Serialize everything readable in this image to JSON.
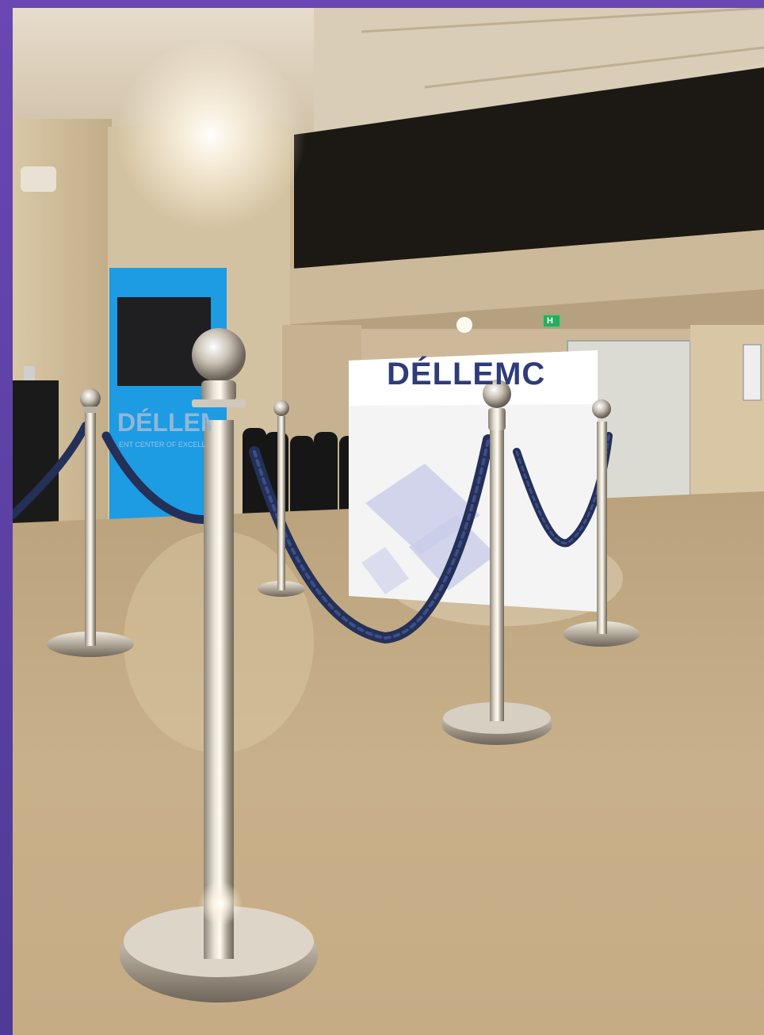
{
  "photo": {
    "subject": "stanchion-queue-lobby",
    "desk_logo": "DÉLLEMC",
    "banner_logo": "DÉLLEM",
    "banner_sub": "ENT CENTER OF EXCELL",
    "exit_sign": "H"
  },
  "colors": {
    "frame": "#5b3f9c",
    "banner_blue": "#1d9be3",
    "logo_navy": "#2f3c79",
    "rope_navy": "#243057",
    "floor": "#c4ad86",
    "chrome": "#c9c3b8"
  }
}
